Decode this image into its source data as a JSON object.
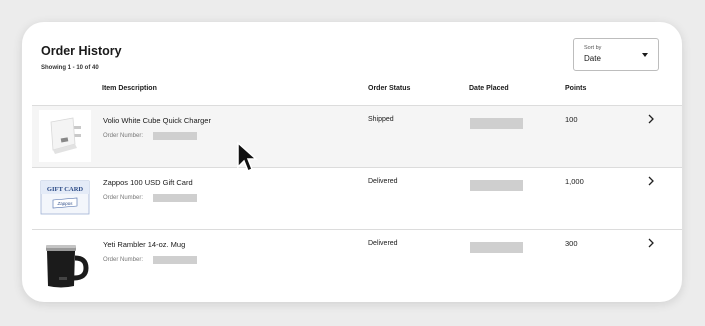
{
  "header": {
    "title": "Order History",
    "showing": "Showing 1 - 10 of 40"
  },
  "sort": {
    "label": "Sort by",
    "value": "Date"
  },
  "columns": {
    "item": "Item Description",
    "status": "Order Status",
    "date": "Date Placed",
    "points": "Points"
  },
  "orders": [
    {
      "name": "Volio White Cube Quick Charger",
      "order_number_label": "Order Number:",
      "status": "Shipped",
      "points": "100",
      "thumb_icon": "usb-charger-image"
    },
    {
      "name": "Zappos 100 USD Gift Card",
      "order_number_label": "Order Number:",
      "status": "Delivered",
      "points": "1,000",
      "thumb_icon": "gift-card-image",
      "thumb_text": "GIFT CARD",
      "thumb_brand": "Zappos"
    },
    {
      "name": "Yeti Rambler 14-oz. Mug",
      "order_number_label": "Order Number:",
      "status": "Delivered",
      "points": "300",
      "thumb_icon": "mug-image"
    }
  ],
  "colors": {
    "background": "#ececec",
    "card": "#ffffff",
    "row_hover": "#f5f5f5",
    "redacted": "#cfcfcf"
  }
}
